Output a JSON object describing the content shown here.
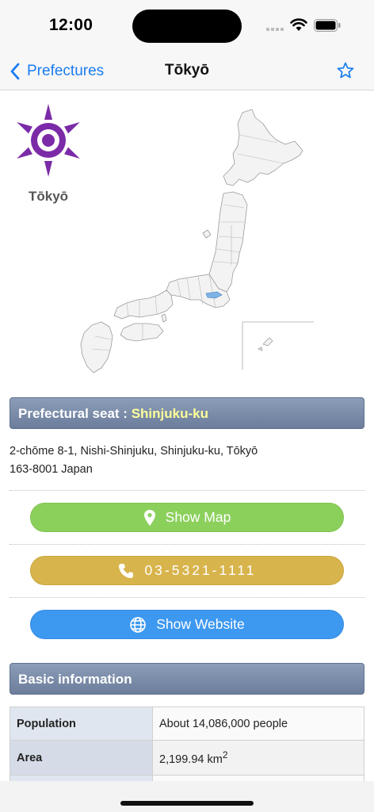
{
  "status_bar": {
    "time": "12:00"
  },
  "nav": {
    "back_label": "Prefectures",
    "title": "Tōkyō"
  },
  "emblem": {
    "caption": "Tōkyō",
    "color": "#7b2aa8"
  },
  "seat": {
    "label": "Prefectural seat : ",
    "value": "Shinjuku-ku"
  },
  "address": {
    "line1": "2-chōme 8-1, Nishi-Shinjuku, Shinjuku-ku, Tōkyō",
    "line2": "163-8001 Japan"
  },
  "actions": {
    "map_label": "Show Map",
    "phone_label": "03-5321-1111",
    "website_label": "Show Website"
  },
  "basic_info": {
    "header": "Basic information",
    "rows": [
      {
        "label": "Population",
        "value": "About 14,086,000 people"
      },
      {
        "label": "Area",
        "value": "2,199.94 km",
        "sup": "2"
      }
    ]
  },
  "colors": {
    "accent": "#1a7cf0",
    "map_button": "#8cd05c",
    "phone_button": "#d8b44c",
    "website_button": "#3d98f0",
    "highlight": "#7fb3e6"
  },
  "icons": [
    "chevron-left-icon",
    "star-icon",
    "map-pin-icon",
    "phone-icon",
    "globe-icon",
    "wifi-icon",
    "battery-icon"
  ]
}
